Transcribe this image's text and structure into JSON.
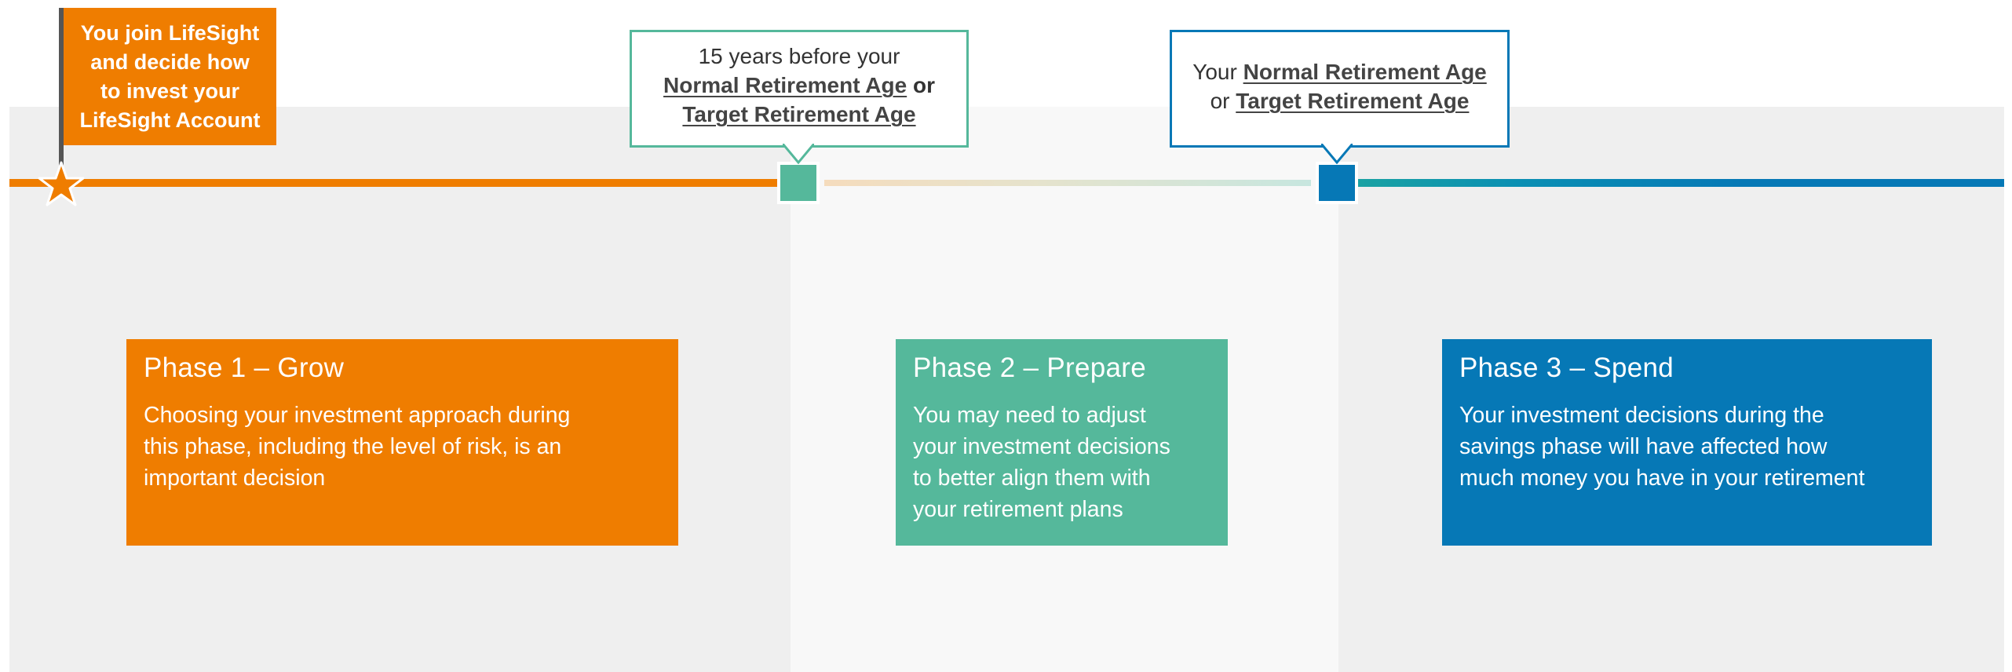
{
  "flag": {
    "lines": [
      "You join LifeSight",
      "and decide how",
      "to invest your",
      "LifeSight Account"
    ],
    "icon": "star-icon"
  },
  "callout_15y": {
    "line1": "15 years before your",
    "line2_link": "Normal Retirement Age",
    "line2_suffix": " or",
    "line3_link": "Target Retirement Age"
  },
  "callout_nra": {
    "line1_prefix": "Your ",
    "line1_link": "Normal Retirement Age",
    "line2_prefix": "or ",
    "line2_link": "Target Retirement Age"
  },
  "phases": [
    {
      "title": "Phase 1 – Grow",
      "lines": [
        "Choosing your investment approach during",
        "this phase, including the level of risk, is an",
        "important decision"
      ]
    },
    {
      "title": "Phase 2 – Prepare",
      "lines": [
        "You may need to adjust",
        "your investment decisions",
        "to better align them with",
        "your retirement plans"
      ]
    },
    {
      "title": "Phase 3 – Spend",
      "lines": [
        "Your investment decisions during the",
        "savings phase will have affected how",
        "much money you have in your retirement"
      ]
    }
  ],
  "colors": {
    "orange": "#ef7d00",
    "teal": "#55b89b",
    "blue": "#0678b6"
  }
}
